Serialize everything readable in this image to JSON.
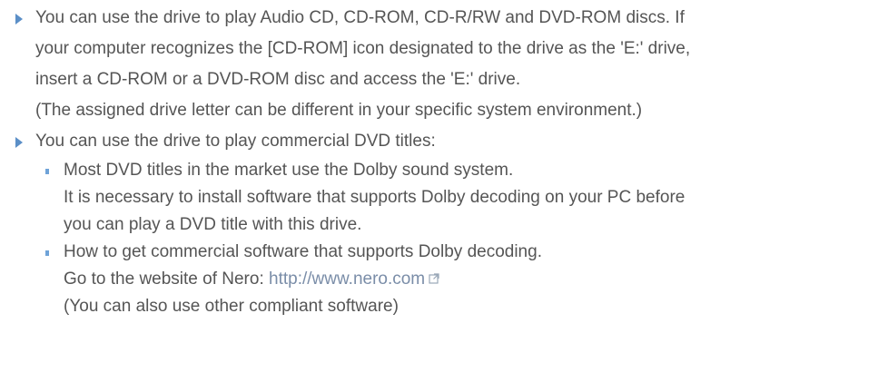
{
  "bullets": [
    {
      "lines": [
        "You can use the drive to play Audio CD, CD-ROM, CD-R/RW and DVD-ROM discs. If",
        "your computer recognizes the [CD-ROM] icon designated to the drive as the 'E:' drive,",
        "insert a CD-ROM or a DVD-ROM disc and access the 'E:' drive.",
        "(The assigned drive letter can be different in your specific system environment.)"
      ]
    },
    {
      "lines": [
        "You can use the drive to play commercial DVD titles:"
      ],
      "sub": [
        {
          "lines": [
            "Most DVD titles in the market use the Dolby sound system.",
            "It is necessary to install software that supports Dolby decoding on your PC before",
            "you can play a DVD title with this drive."
          ]
        },
        {
          "lines": [
            "How to get commercial software that supports Dolby decoding."
          ],
          "link_prefix": "Go to the website of Nero: ",
          "link_text": "http://www.nero.com",
          "link_icon": "external-link-icon",
          "after": "(You can also use other compliant software)"
        }
      ]
    }
  ],
  "colors": {
    "text": "#555555",
    "bullet": "#5b8fc7",
    "sub_bullet": "#6fa3d8",
    "link": "#7a8da8"
  }
}
